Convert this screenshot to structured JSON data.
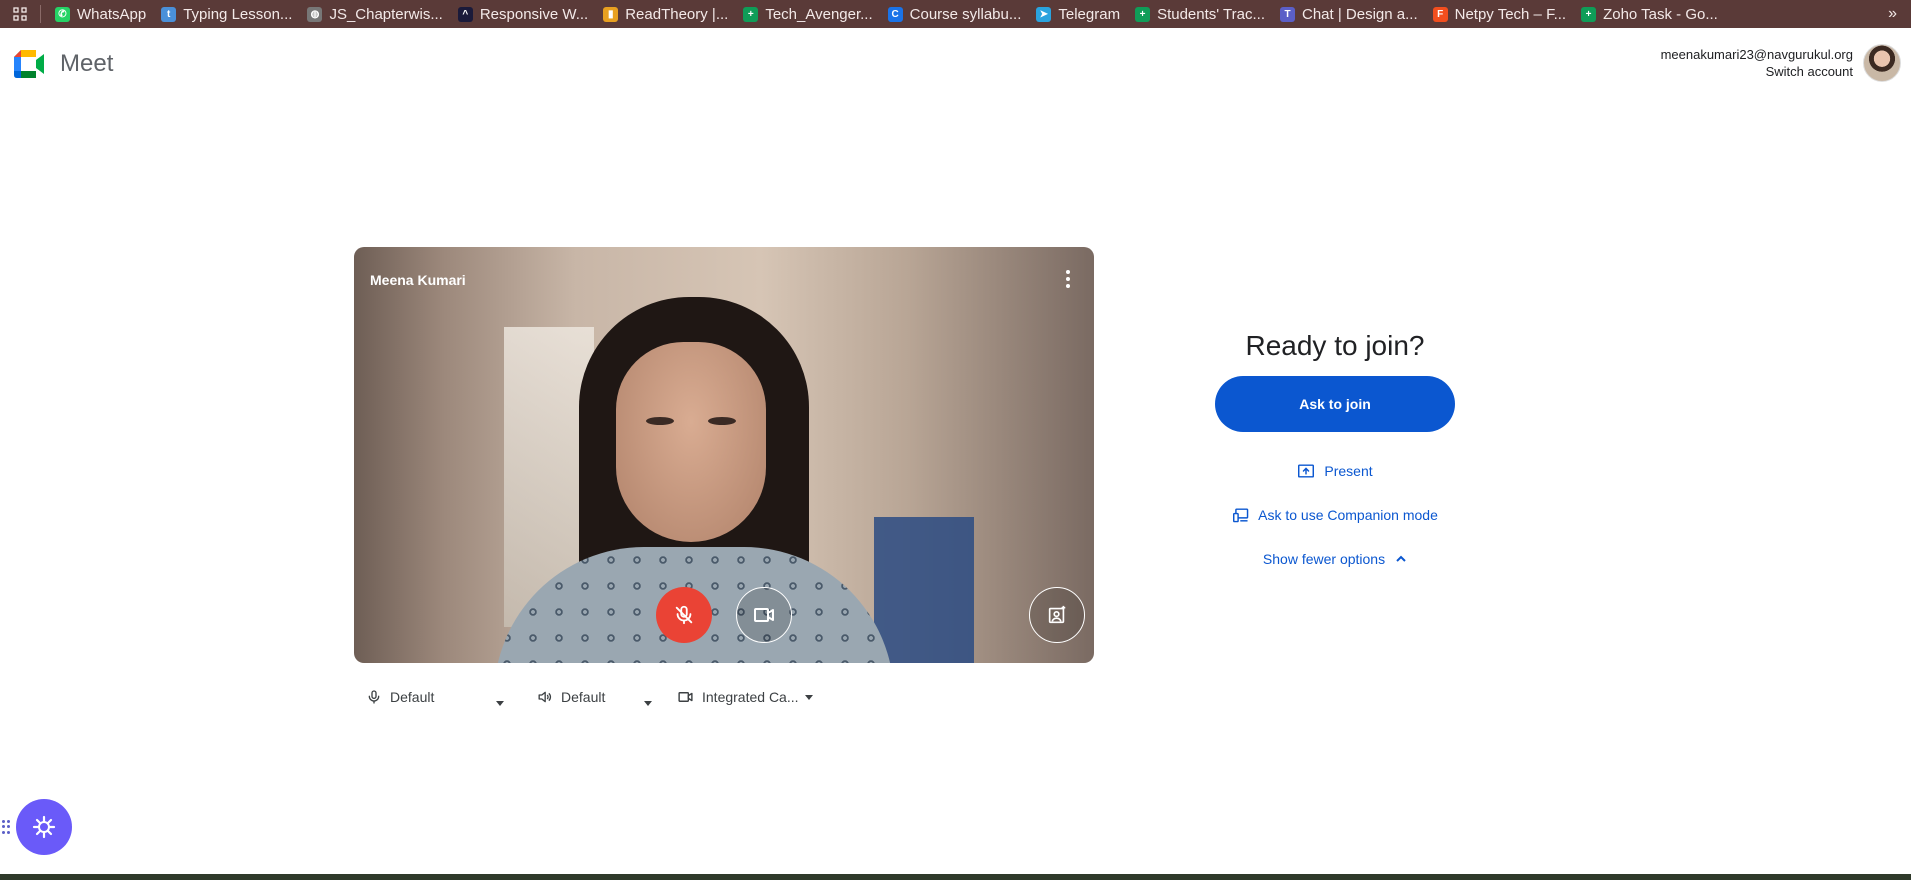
{
  "bookmarks": [
    {
      "label": "WhatsApp",
      "icon": "whatsapp-icon",
      "color": "#25d366",
      "glyph": "✆"
    },
    {
      "label": "Typing Lesson...",
      "icon": "typing-icon",
      "color": "#4a90d9",
      "glyph": "t"
    },
    {
      "label": "JS_Chapterwis...",
      "icon": "globe-icon",
      "color": "#777777",
      "glyph": "◍"
    },
    {
      "label": "Responsive W...",
      "icon": "responsive-icon",
      "color": "#1a1a3a",
      "glyph": "^"
    },
    {
      "label": "ReadTheory |...",
      "icon": "readtheory-icon",
      "color": "#e8a020",
      "glyph": "▮"
    },
    {
      "label": "Tech_Avenger...",
      "icon": "sheets-icon",
      "color": "#0f9d58",
      "glyph": "+"
    },
    {
      "label": "Course syllabu...",
      "icon": "course-icon",
      "color": "#1a73e8",
      "glyph": "C"
    },
    {
      "label": "Telegram",
      "icon": "telegram-icon",
      "color": "#2aa3de",
      "glyph": "➤"
    },
    {
      "label": "Students' Trac...",
      "icon": "sheets-icon",
      "color": "#0f9d58",
      "glyph": "+"
    },
    {
      "label": "Chat | Design a...",
      "icon": "teams-icon",
      "color": "#5b5fc7",
      "glyph": "T"
    },
    {
      "label": "Netpy Tech – F...",
      "icon": "figma-icon",
      "color": "#f24e1e",
      "glyph": "F"
    },
    {
      "label": "Zoho Task - Go...",
      "icon": "sheets-icon",
      "color": "#0f9d58",
      "glyph": "+"
    }
  ],
  "more_bookmarks": "»",
  "app": {
    "title": "Meet"
  },
  "account": {
    "email": "meenakumari23@navgurukul.org",
    "switch_label": "Switch account"
  },
  "video": {
    "participant_name": "Meena Kumari"
  },
  "devices": {
    "microphone": "Default",
    "speaker": "Default",
    "camera": "Integrated Ca..."
  },
  "join": {
    "title": "Ready to join?",
    "ask_to_join": "Ask to join",
    "present": "Present",
    "companion": "Ask to use Companion mode",
    "fewer_options": "Show fewer options"
  },
  "colors": {
    "accent": "#0b57d0",
    "mic_off": "#ea4335",
    "bookmark_bar": "#5a3a38"
  }
}
